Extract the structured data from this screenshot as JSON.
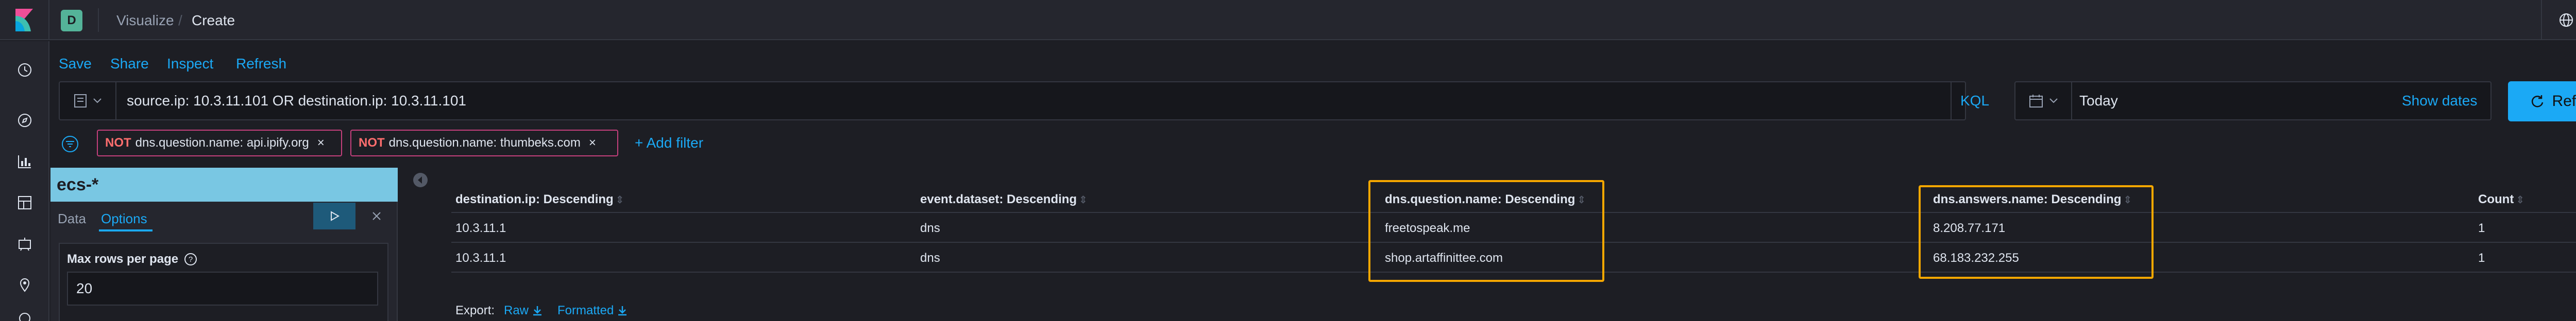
{
  "header": {
    "space_initial": "D",
    "breadcrumbs": [
      "Visualize",
      "Create"
    ],
    "separator": "/"
  },
  "top_nav": [
    "Save",
    "Share",
    "Inspect",
    "Refresh"
  ],
  "query": {
    "text": "source.ip: 10.3.11.101 OR destination.ip: 10.3.11.101",
    "language": "KQL"
  },
  "date_picker": {
    "value": "Today",
    "show_dates": "Show dates",
    "refresh": "Refresh"
  },
  "filters": [
    {
      "negation": "NOT",
      "text": "dns.question.name: api.ipify.org",
      "remove": "×"
    },
    {
      "negation": "NOT",
      "text": "dns.question.name: thumbeks.com",
      "remove": "×"
    }
  ],
  "add_filter": "+ Add filter",
  "editor": {
    "index_pattern": "ecs-*",
    "tabs": [
      "Data",
      "Options"
    ],
    "max_rows_label": "Max rows per page",
    "max_rows_value": "20"
  },
  "table": {
    "columns": [
      "destination.ip: Descending",
      "event.dataset: Descending",
      "dns.question.name: Descending",
      "dns.answers.name: Descending",
      "Count"
    ],
    "sort_glyph": "⇕",
    "rows": [
      [
        "10.3.11.1",
        "dns",
        "freetospeak.me",
        "8.208.77.171",
        "1"
      ],
      [
        "10.3.11.1",
        "dns",
        "shop.artaffinittee.com",
        "68.183.232.255",
        "1"
      ]
    ]
  },
  "export": {
    "label": "Export:",
    "raw": "Raw",
    "formatted": "Formatted"
  },
  "colors": {
    "accent": "#1ba9f5",
    "highlight": "#f5a700",
    "avatar": "#54b399",
    "negate": "#ff6e6e",
    "index_bar": "#79c7e3"
  },
  "icons": {
    "rail": [
      "clock-icon",
      "compass-icon",
      "bar-chart-icon",
      "dashboard-icon",
      "canvas-icon",
      "maps-icon",
      "ml-icon"
    ],
    "header_right": [
      "help-globe-icon",
      "mail-icon"
    ]
  }
}
